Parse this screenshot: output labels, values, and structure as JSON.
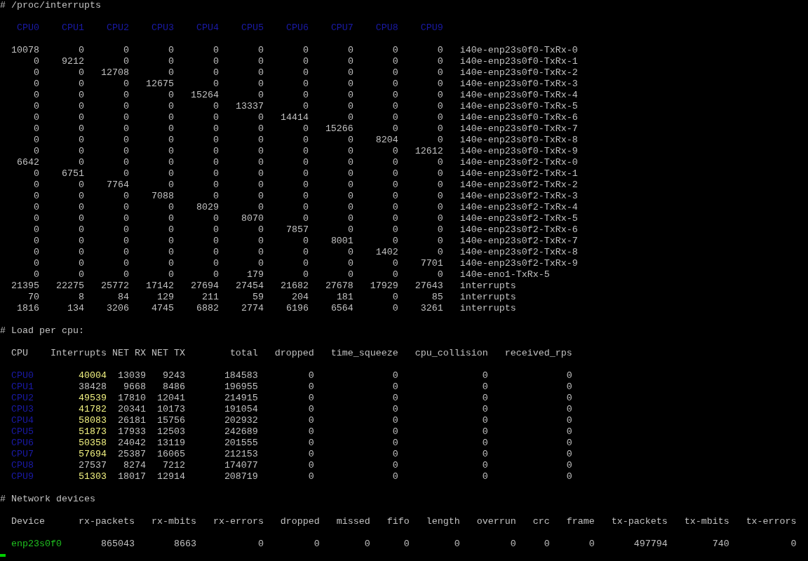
{
  "interrupts": {
    "title": "# /proc/interrupts",
    "columns": [
      "CPU0",
      "CPU1",
      "CPU2",
      "CPU3",
      "CPU4",
      "CPU5",
      "CPU6",
      "CPU7",
      "CPU8",
      "CPU9"
    ],
    "rows": [
      {
        "counts": [
          "10078",
          "0",
          "0",
          "0",
          "0",
          "0",
          "0",
          "0",
          "0",
          "0"
        ],
        "label": "i40e-enp23s0f0-TxRx-0"
      },
      {
        "counts": [
          "0",
          "9212",
          "0",
          "0",
          "0",
          "0",
          "0",
          "0",
          "0",
          "0"
        ],
        "label": "i40e-enp23s0f0-TxRx-1"
      },
      {
        "counts": [
          "0",
          "0",
          "12708",
          "0",
          "0",
          "0",
          "0",
          "0",
          "0",
          "0"
        ],
        "label": "i40e-enp23s0f0-TxRx-2"
      },
      {
        "counts": [
          "0",
          "0",
          "0",
          "12675",
          "0",
          "0",
          "0",
          "0",
          "0",
          "0"
        ],
        "label": "i40e-enp23s0f0-TxRx-3"
      },
      {
        "counts": [
          "0",
          "0",
          "0",
          "0",
          "15264",
          "0",
          "0",
          "0",
          "0",
          "0"
        ],
        "label": "i40e-enp23s0f0-TxRx-4"
      },
      {
        "counts": [
          "0",
          "0",
          "0",
          "0",
          "0",
          "13337",
          "0",
          "0",
          "0",
          "0"
        ],
        "label": "i40e-enp23s0f0-TxRx-5"
      },
      {
        "counts": [
          "0",
          "0",
          "0",
          "0",
          "0",
          "0",
          "14414",
          "0",
          "0",
          "0"
        ],
        "label": "i40e-enp23s0f0-TxRx-6"
      },
      {
        "counts": [
          "0",
          "0",
          "0",
          "0",
          "0",
          "0",
          "0",
          "15266",
          "0",
          "0"
        ],
        "label": "i40e-enp23s0f0-TxRx-7"
      },
      {
        "counts": [
          "0",
          "0",
          "0",
          "0",
          "0",
          "0",
          "0",
          "0",
          "8204",
          "0"
        ],
        "label": "i40e-enp23s0f0-TxRx-8"
      },
      {
        "counts": [
          "0",
          "0",
          "0",
          "0",
          "0",
          "0",
          "0",
          "0",
          "0",
          "12612"
        ],
        "label": "i40e-enp23s0f0-TxRx-9"
      },
      {
        "counts": [
          "6642",
          "0",
          "0",
          "0",
          "0",
          "0",
          "0",
          "0",
          "0",
          "0"
        ],
        "label": "i40e-enp23s0f2-TxRx-0"
      },
      {
        "counts": [
          "0",
          "6751",
          "0",
          "0",
          "0",
          "0",
          "0",
          "0",
          "0",
          "0"
        ],
        "label": "i40e-enp23s0f2-TxRx-1"
      },
      {
        "counts": [
          "0",
          "0",
          "7764",
          "0",
          "0",
          "0",
          "0",
          "0",
          "0",
          "0"
        ],
        "label": "i40e-enp23s0f2-TxRx-2"
      },
      {
        "counts": [
          "0",
          "0",
          "0",
          "7088",
          "0",
          "0",
          "0",
          "0",
          "0",
          "0"
        ],
        "label": "i40e-enp23s0f2-TxRx-3"
      },
      {
        "counts": [
          "0",
          "0",
          "0",
          "0",
          "8029",
          "0",
          "0",
          "0",
          "0",
          "0"
        ],
        "label": "i40e-enp23s0f2-TxRx-4"
      },
      {
        "counts": [
          "0",
          "0",
          "0",
          "0",
          "0",
          "8070",
          "0",
          "0",
          "0",
          "0"
        ],
        "label": "i40e-enp23s0f2-TxRx-5"
      },
      {
        "counts": [
          "0",
          "0",
          "0",
          "0",
          "0",
          "0",
          "7857",
          "0",
          "0",
          "0"
        ],
        "label": "i40e-enp23s0f2-TxRx-6"
      },
      {
        "counts": [
          "0",
          "0",
          "0",
          "0",
          "0",
          "0",
          "0",
          "8001",
          "0",
          "0"
        ],
        "label": "i40e-enp23s0f2-TxRx-7"
      },
      {
        "counts": [
          "0",
          "0",
          "0",
          "0",
          "0",
          "0",
          "0",
          "0",
          "1402",
          "0"
        ],
        "label": "i40e-enp23s0f2-TxRx-8"
      },
      {
        "counts": [
          "0",
          "0",
          "0",
          "0",
          "0",
          "0",
          "0",
          "0",
          "0",
          "7701"
        ],
        "label": "i40e-enp23s0f2-TxRx-9"
      },
      {
        "counts": [
          "0",
          "0",
          "0",
          "0",
          "0",
          "179",
          "0",
          "0",
          "0",
          "0"
        ],
        "label": "i40e-eno1-TxRx-5"
      },
      {
        "counts": [
          "21395",
          "22275",
          "25772",
          "17142",
          "27694",
          "27454",
          "21682",
          "27678",
          "17929",
          "27643"
        ],
        "label": "interrupts"
      },
      {
        "counts": [
          "70",
          "8",
          "84",
          "129",
          "211",
          "59",
          "204",
          "181",
          "0",
          "85"
        ],
        "label": "interrupts"
      },
      {
        "counts": [
          "1816",
          "134",
          "3206",
          "4745",
          "6882",
          "2774",
          "6196",
          "6564",
          "0",
          "3261"
        ],
        "label": "interrupts"
      }
    ]
  },
  "load_per_cpu": {
    "title": "# Load per cpu:",
    "columns": [
      "CPU",
      "Interrupts",
      "NET RX",
      "NET TX",
      "total",
      "dropped",
      "time_squeeze",
      "cpu_collision",
      "received_rps"
    ],
    "rows": [
      {
        "highlighted": true,
        "cells": [
          "CPU0",
          "40004",
          "13039",
          "9243",
          "184583",
          "0",
          "0",
          "0",
          "0"
        ]
      },
      {
        "highlighted": false,
        "cells": [
          "CPU1",
          "38428",
          "9668",
          "8486",
          "196955",
          "0",
          "0",
          "0",
          "0"
        ]
      },
      {
        "highlighted": true,
        "cells": [
          "CPU2",
          "49539",
          "17810",
          "12041",
          "214915",
          "0",
          "0",
          "0",
          "0"
        ]
      },
      {
        "highlighted": true,
        "cells": [
          "CPU3",
          "41782",
          "20341",
          "10173",
          "191054",
          "0",
          "0",
          "0",
          "0"
        ]
      },
      {
        "highlighted": true,
        "cells": [
          "CPU4",
          "58083",
          "26181",
          "15756",
          "202932",
          "0",
          "0",
          "0",
          "0"
        ]
      },
      {
        "highlighted": true,
        "cells": [
          "CPU5",
          "51873",
          "17933",
          "12503",
          "242689",
          "0",
          "0",
          "0",
          "0"
        ]
      },
      {
        "highlighted": true,
        "cells": [
          "CPU6",
          "50358",
          "24042",
          "13119",
          "201555",
          "0",
          "0",
          "0",
          "0"
        ]
      },
      {
        "highlighted": true,
        "cells": [
          "CPU7",
          "57694",
          "25387",
          "16065",
          "212153",
          "0",
          "0",
          "0",
          "0"
        ]
      },
      {
        "highlighted": false,
        "cells": [
          "CPU8",
          "27537",
          "8274",
          "7212",
          "174077",
          "0",
          "0",
          "0",
          "0"
        ]
      },
      {
        "highlighted": true,
        "cells": [
          "CPU9",
          "51303",
          "18017",
          "12914",
          "208719",
          "0",
          "0",
          "0",
          "0"
        ]
      }
    ]
  },
  "network_devices": {
    "title": "# Network devices",
    "columns": [
      "Device",
      "rx-packets",
      "rx-mbits",
      "rx-errors",
      "dropped",
      "missed",
      "fifo",
      "length",
      "overrun",
      "crc",
      "frame",
      "tx-packets",
      "tx-mbits",
      "tx-errors"
    ],
    "rows": [
      {
        "cells": [
          "enp23s0f0",
          "865043",
          "8663",
          "0",
          "0",
          "0",
          "0",
          "0",
          "0",
          "0",
          "0",
          "497794",
          "740",
          "0"
        ]
      }
    ]
  }
}
